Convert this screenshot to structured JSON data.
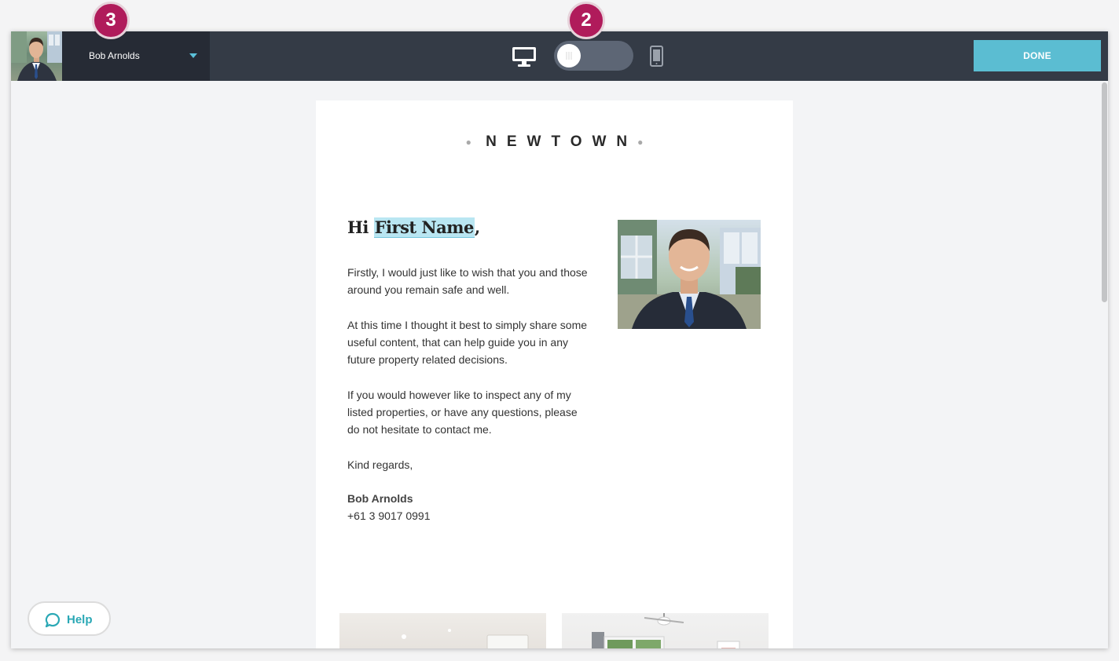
{
  "header": {
    "user_name": "Bob Arnolds",
    "done_label": "DONE",
    "device_toggle": "desktop"
  },
  "email": {
    "brand": "NEWTOWN",
    "greeting_prefix": "Hi ",
    "greeting_token": "First Name",
    "greeting_suffix": ",",
    "paragraphs": [
      "Firstly, I would just like to wish that you and those around you remain safe and well.",
      "At this time I thought it best to simply share some useful content, that can help guide you in any future property related decisions.",
      "If you would however like to inspect any of my listed properties, or have any questions, please do not hesitate to contact me.",
      "Kind regards,"
    ],
    "signature_name": "Bob Arnolds",
    "signature_phone": "+61 3 9017 0991"
  },
  "help": {
    "label": "Help"
  },
  "badges": {
    "step_3": "3",
    "step_2": "2"
  },
  "colors": {
    "topbar": "#343b46",
    "accent": "#5bbdd2",
    "badge": "#b01b5b",
    "help_text": "#2aa8b5"
  }
}
